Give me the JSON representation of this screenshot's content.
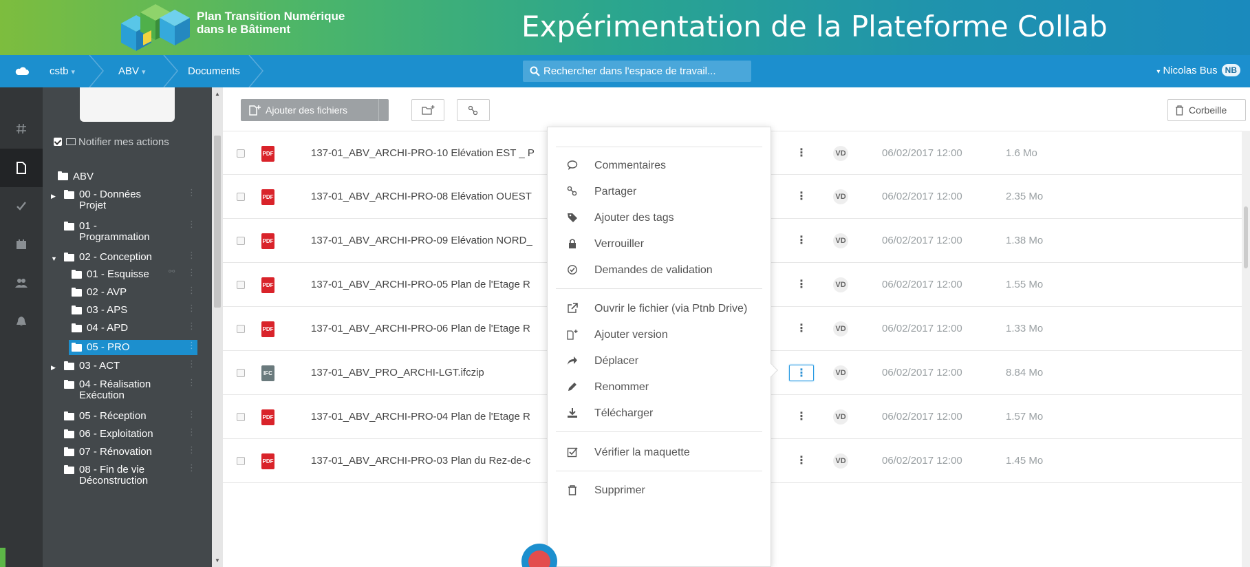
{
  "banner": {
    "subtitle_line1": "Plan Transition Numérique",
    "subtitle_line2": "dans le Bâtiment",
    "title": "Expérimentation de la Plateforme Collab"
  },
  "navbar": {
    "crumbs": [
      {
        "label": "cstb",
        "caret": "▾"
      },
      {
        "label": "ABV",
        "caret": "▾"
      },
      {
        "label": "Documents",
        "caret": ""
      }
    ],
    "search_placeholder": "Rechercher dans l'espace de travail...",
    "user_name": "Nicolas Bus",
    "user_initials": "NB",
    "user_caret": "▾"
  },
  "rail": {
    "items": [
      {
        "icon": "hash-icon",
        "active": false
      },
      {
        "icon": "document-icon",
        "active": true
      },
      {
        "icon": "check-icon",
        "active": false
      },
      {
        "icon": "calendar-icon",
        "active": false
      },
      {
        "icon": "users-icon",
        "active": false
      },
      {
        "icon": "bell-icon",
        "active": false
      }
    ]
  },
  "sidebar": {
    "notify_label": "Notifier mes actions",
    "tree": [
      {
        "label": "ABV",
        "label2": "",
        "expander": ""
      },
      {
        "label": "00 - Données",
        "label2": "Projet",
        "expander": "▶"
      },
      {
        "label": "01 -",
        "label2": "Programmation",
        "expander": ""
      },
      {
        "label": "02 - Conception",
        "label2": "",
        "expander": "▼"
      },
      {
        "label": "01 - Esquisse",
        "label2": "",
        "expander": ""
      },
      {
        "label": "02 - AVP",
        "label2": "",
        "expander": ""
      },
      {
        "label": "03 - APS",
        "label2": "",
        "expander": ""
      },
      {
        "label": "04 - APD",
        "label2": "",
        "expander": ""
      },
      {
        "label": "05 - PRO",
        "label2": "",
        "expander": ""
      },
      {
        "label": "03 - ACT",
        "label2": "",
        "expander": "▶"
      },
      {
        "label": "04 - Réalisation",
        "label2": "Exécution",
        "expander": ""
      },
      {
        "label": "05 - Réception",
        "label2": "",
        "expander": ""
      },
      {
        "label": "06 - Exploitation",
        "label2": "",
        "expander": ""
      },
      {
        "label": "07 - Rénovation",
        "label2": "",
        "expander": ""
      },
      {
        "label": "08 - Fin de vie",
        "label2": "Déconstruction",
        "expander": ""
      }
    ],
    "selected": "05 - PRO"
  },
  "toolbar": {
    "add_files_label": "Ajouter des fichiers",
    "add_files_caret": "▾",
    "trash_label": "Corbeille"
  },
  "files": [
    {
      "type": "PDF",
      "name": "137-01_ABV_ARCHI-PRO-10 Elévation EST _ P",
      "owner": "VD",
      "date": "06/02/2017 12:00",
      "size": "1.6 Mo"
    },
    {
      "type": "PDF",
      "name": "137-01_ABV_ARCHI-PRO-08 Elévation OUEST",
      "owner": "VD",
      "date": "06/02/2017 12:00",
      "size": "2.35 Mo"
    },
    {
      "type": "PDF",
      "name": "137-01_ABV_ARCHI-PRO-09 Elévation NORD_",
      "owner": "VD",
      "date": "06/02/2017 12:00",
      "size": "1.38 Mo"
    },
    {
      "type": "PDF",
      "name": "137-01_ABV_ARCHI-PRO-05 Plan de l'Etage R",
      "owner": "VD",
      "date": "06/02/2017 12:00",
      "size": "1.55 Mo"
    },
    {
      "type": "PDF",
      "name": "137-01_ABV_ARCHI-PRO-06 Plan de l'Etage R",
      "owner": "VD",
      "date": "06/02/2017 12:00",
      "size": "1.33 Mo"
    },
    {
      "type": "IFC",
      "name": "137-01_ABV_PRO_ARCHI-LGT.ifczip",
      "owner": "VD",
      "date": "06/02/2017 12:00",
      "size": "8.84 Mo"
    },
    {
      "type": "PDF",
      "name": "137-01_ABV_ARCHI-PRO-04 Plan de l'Etage R",
      "owner": "VD",
      "date": "06/02/2017 12:00",
      "size": "1.57 Mo"
    },
    {
      "type": "PDF",
      "name": "137-01_ABV_ARCHI-PRO-03 Plan du Rez-de-c",
      "owner": "VD",
      "date": "06/02/2017 12:00",
      "size": "1.45 Mo"
    }
  ],
  "row_kebab": "⋮",
  "context_menu": {
    "items": [
      {
        "icon": "comment-icon",
        "label": "Commentaires"
      },
      {
        "icon": "share-icon",
        "label": "Partager"
      },
      {
        "icon": "tag-icon",
        "label": "Ajouter des tags"
      },
      {
        "icon": "lock-icon",
        "label": "Verrouiller"
      },
      {
        "icon": "validation-icon",
        "label": "Demandes de validation"
      },
      {
        "icon": "external-link-icon",
        "label": "Ouvrir le fichier (via Ptnb Drive)"
      },
      {
        "icon": "add-version-icon",
        "label": "Ajouter version"
      },
      {
        "icon": "move-arrow-icon",
        "label": "Déplacer"
      },
      {
        "icon": "pencil-icon",
        "label": "Renommer"
      },
      {
        "icon": "download-icon",
        "label": "Télécharger"
      },
      {
        "icon": "check-square-icon",
        "label": "Vérifier la maquette"
      },
      {
        "icon": "trash-icon",
        "label": "Supprimer"
      }
    ]
  },
  "colors": {
    "nav_blue": "#1c8fce",
    "sidebar": "#43484b",
    "rail": "#333638",
    "pdf_red": "#d9232a"
  }
}
